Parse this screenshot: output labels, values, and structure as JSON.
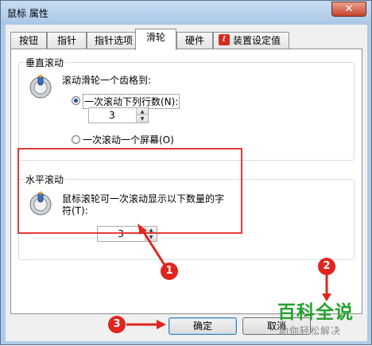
{
  "window": {
    "title": "鼠标 属性",
    "close_glyph": "✕"
  },
  "tabs": [
    {
      "label": "按钮"
    },
    {
      "label": "指针"
    },
    {
      "label": "指针选项"
    },
    {
      "label": "滑轮"
    },
    {
      "label": "硬件"
    },
    {
      "label": "装置设定值"
    }
  ],
  "vertical_scroll": {
    "group_title": "垂直滚动",
    "description": "滚动滑轮一个齿格到:",
    "option_lines": "一次滚动下列行数(N):",
    "lines_value": "3",
    "option_screen": "一次滚动一个屏幕(O)"
  },
  "horizontal_scroll": {
    "group_title": "水平滚动",
    "description_line1": "鼠标滚轮可一次滚动显示以下数量的字",
    "description_line2": "符(T):",
    "chars_value": "3"
  },
  "buttons": {
    "ok": "确定",
    "cancel": "取消"
  },
  "annotations": {
    "badge1": "1",
    "badge2": "2",
    "badge3": "3"
  },
  "watermark": {
    "main": "百科全说",
    "sub": "助你轻松解决"
  },
  "colors": {
    "highlight_red": "#e53935",
    "badge_red": "#e0251f",
    "watermark_green": "#27a12e"
  }
}
